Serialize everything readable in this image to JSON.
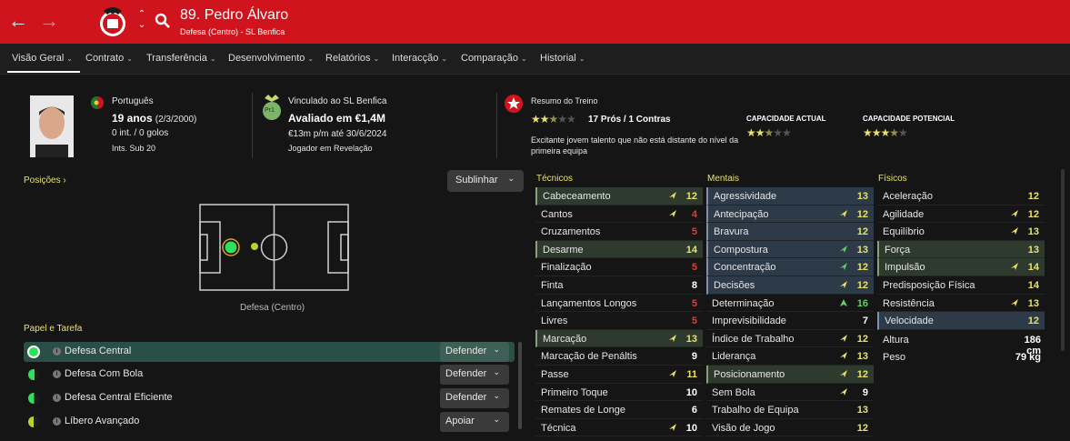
{
  "header": {
    "title": "89. Pedro Álvaro",
    "subtitle": "Defesa (Centro) - SL Benfica",
    "back_icon": "←",
    "forward_icon": "→"
  },
  "nav": {
    "tabs": [
      "Visão Geral",
      "Contrato",
      "Transferência",
      "Desenvolvimento",
      "Relatórios",
      "Interacção",
      "Comparação",
      "Historial"
    ]
  },
  "bio": {
    "nationality": "Português",
    "age": "19 anos",
    "dob": "(2/3/2000)",
    "intl": "0 int. / 0 golos",
    "youth_caps": "Ints. Sub 20"
  },
  "contract": {
    "club_line": "Vinculado ao SL Benfica",
    "value": "Avaliado em €1,4M",
    "wage": "€13m p/m até 30/6/2024",
    "status": "Jogador em Revelação",
    "badge": "Pr1"
  },
  "training": {
    "title": "Resumo do Treino",
    "pros_cons": "17 Prós / 1 Contras",
    "current_label": "CAPACIDADE ACTUAL",
    "potential_label": "CAPACIDADE POTENCIAL",
    "rating_stars": 2.5,
    "current_stars": 2.5,
    "potential_stars": 3.5,
    "description": "Excitante jovem talento que não está distante do nível da primeira equipa"
  },
  "positions": {
    "title": "Posições",
    "highlight_button": "Sublinhar",
    "position_label": "Defesa (Centro)"
  },
  "roles": {
    "title": "Papel e Tarefa",
    "items": [
      {
        "name": "Defesa Central",
        "duty": "Defender"
      },
      {
        "name": "Defesa Com Bola",
        "duty": "Defender"
      },
      {
        "name": "Defesa Central Eficiente",
        "duty": "Defender"
      },
      {
        "name": "Líbero Avançado",
        "duty": "Apoiar"
      }
    ]
  },
  "attributes": {
    "technical_title": "Técnicos",
    "mental_title": "Mentais",
    "physical_title": "Físicos",
    "technical": [
      {
        "name": "Cabeceamento",
        "value": "12"
      },
      {
        "name": "Cantos",
        "value": "4"
      },
      {
        "name": "Cruzamentos",
        "value": "5"
      },
      {
        "name": "Desarme",
        "value": "14"
      },
      {
        "name": "Finalização",
        "value": "5"
      },
      {
        "name": "Finta",
        "value": "8"
      },
      {
        "name": "Lançamentos Longos",
        "value": "5"
      },
      {
        "name": "Livres",
        "value": "5"
      },
      {
        "name": "Marcação",
        "value": "13"
      },
      {
        "name": "Marcação de Penáltis",
        "value": "9"
      },
      {
        "name": "Passe",
        "value": "11"
      },
      {
        "name": "Primeiro Toque",
        "value": "10"
      },
      {
        "name": "Remates de Longe",
        "value": "6"
      },
      {
        "name": "Técnica",
        "value": "10"
      }
    ],
    "mental": [
      {
        "name": "Agressividade",
        "value": "13"
      },
      {
        "name": "Antecipação",
        "value": "12"
      },
      {
        "name": "Bravura",
        "value": "12"
      },
      {
        "name": "Compostura",
        "value": "13"
      },
      {
        "name": "Concentração",
        "value": "12"
      },
      {
        "name": "Decisões",
        "value": "12"
      },
      {
        "name": "Determinação",
        "value": "16"
      },
      {
        "name": "Imprevisibilidade",
        "value": "7"
      },
      {
        "name": "Índice de Trabalho",
        "value": "12"
      },
      {
        "name": "Liderança",
        "value": "13"
      },
      {
        "name": "Posicionamento",
        "value": "12"
      },
      {
        "name": "Sem Bola",
        "value": "9"
      },
      {
        "name": "Trabalho de Equipa",
        "value": "13"
      },
      {
        "name": "Visão de Jogo",
        "value": "12"
      }
    ],
    "physical": [
      {
        "name": "Aceleração",
        "value": "12"
      },
      {
        "name": "Agilidade",
        "value": "12"
      },
      {
        "name": "Equilíbrio",
        "value": "13"
      },
      {
        "name": "Força",
        "value": "13"
      },
      {
        "name": "Impulsão",
        "value": "14"
      },
      {
        "name": "Predisposição Física",
        "value": "14"
      },
      {
        "name": "Resistência",
        "value": "13"
      },
      {
        "name": "Velocidade",
        "value": "12"
      }
    ],
    "height_label": "Altura",
    "height": "186 cm",
    "weight_label": "Peso",
    "weight": "79 kg"
  },
  "colors": {
    "brand_red": "#d0141d",
    "attr_yellow": "#e9e26a",
    "attr_red": "#d8413a",
    "attr_green": "#5fd06a"
  }
}
